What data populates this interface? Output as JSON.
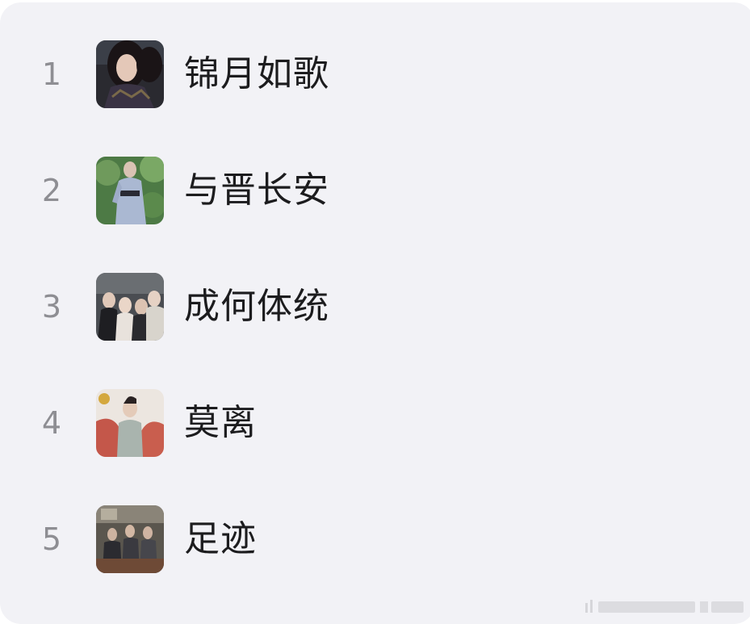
{
  "list": {
    "items": [
      {
        "rank": "1",
        "title": "锦月如歌",
        "thumb_icon": "portrait-woman-dark-hair-icon"
      },
      {
        "rank": "2",
        "title": "与晋长安",
        "thumb_icon": "portrait-costume-blue-robe-icon"
      },
      {
        "rank": "3",
        "title": "成何体统",
        "thumb_icon": "group-photo-four-people-icon"
      },
      {
        "rank": "4",
        "title": "莫离",
        "thumb_icon": "portrait-man-red-backdrop-icon"
      },
      {
        "rank": "5",
        "title": "足迹",
        "thumb_icon": "group-photo-seated-men-icon"
      }
    ]
  },
  "colors": {
    "background": "#f2f2f6",
    "rank_text": "#8e8e93",
    "title_text": "#1c1c1e"
  }
}
